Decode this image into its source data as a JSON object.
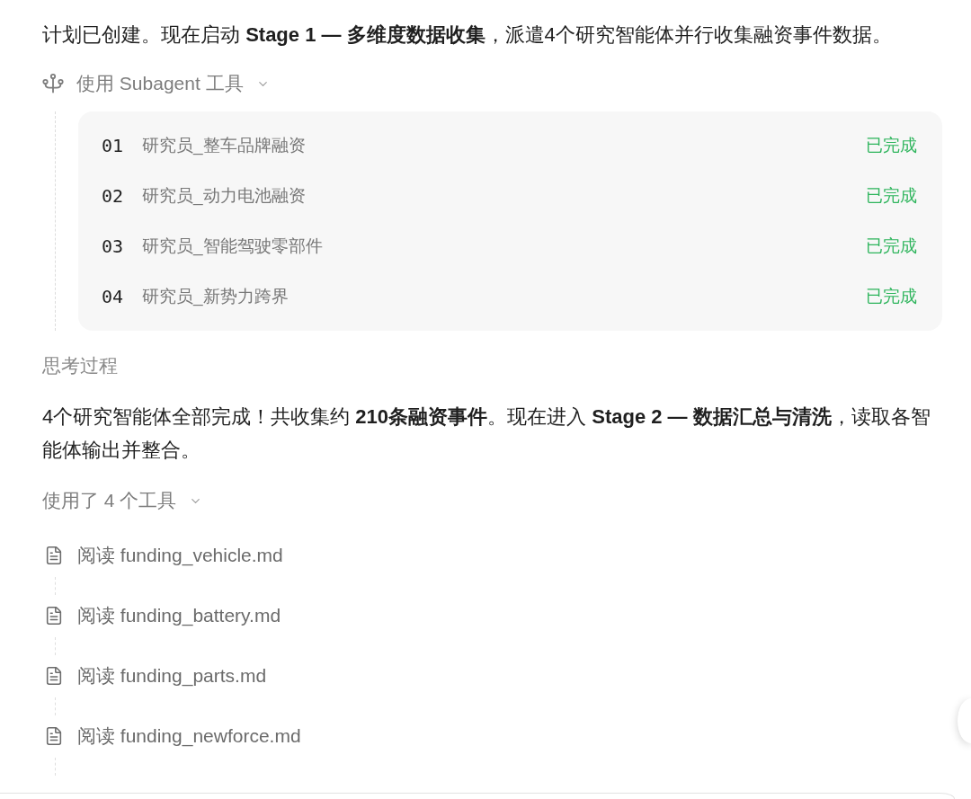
{
  "intro": {
    "text": "计划已创建。现在启动 **Stage 1 — 多维度数据收集**，派遣4个研究智能体并行收集融资事件数据。"
  },
  "subagent_tool": {
    "label": "使用 Subagent 工具",
    "expanded": true,
    "agents": [
      {
        "number": "01",
        "name": "研究员_整车品牌融资",
        "status": "已完成",
        "done": true
      },
      {
        "number": "02",
        "name": "研究员_动力电池融资",
        "status": "已完成",
        "done": true
      },
      {
        "number": "03",
        "name": "研究员_智能驾驶零部件",
        "status": "已完成",
        "done": true
      },
      {
        "number": "04",
        "name": "研究员_新势力跨界",
        "status": "已完成",
        "done": true
      }
    ]
  },
  "thinking": {
    "label": "思考过程"
  },
  "summary": {
    "text": "4个研究智能体全部完成！共收集约 **210条融资事件**。现在进入 **Stage 2 — 数据汇总与清洗**，读取各智能体输出并整合。"
  },
  "tools": {
    "label": "使用了 4 个工具",
    "expanded": true,
    "items": [
      {
        "text": "阅读 funding_vehicle.md"
      },
      {
        "text": "阅读 funding_battery.md"
      },
      {
        "text": "阅读 funding_parts.md"
      },
      {
        "text": "阅读 funding_newforce.md"
      }
    ]
  }
}
